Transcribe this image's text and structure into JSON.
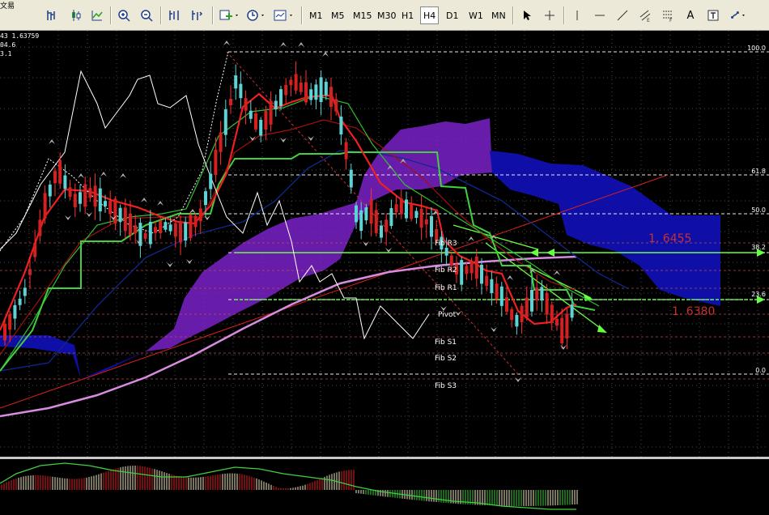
{
  "menu_fragment": "文易",
  "toolbar": {
    "timeframes": [
      "M1",
      "M5",
      "M15",
      "M30",
      "H1",
      "H4",
      "D1",
      "W1",
      "MN"
    ],
    "active_timeframe": "H4"
  },
  "info": {
    "line1": "43 1.63759",
    "line2": "04.6",
    "line3": "3.1"
  },
  "fib_levels": [
    {
      "label": "100.0"
    },
    {
      "label": "61.8"
    },
    {
      "label": "50.0"
    },
    {
      "label": "38.2"
    },
    {
      "label": "23.6"
    },
    {
      "label": "0.0"
    }
  ],
  "pivots": [
    {
      "label": "Fib R3"
    },
    {
      "label": "Fib R2"
    },
    {
      "label": "Fib R1"
    },
    {
      "label": "Pivot"
    },
    {
      "label": "Fib S1"
    },
    {
      "label": "Fib S2"
    },
    {
      "label": "Fib S3"
    }
  ],
  "annotations": {
    "upper_price": "1. 6455",
    "lower_price": "1. 6380"
  },
  "colors": {
    "background": "#000000",
    "bull_candle": "#5fd3d3",
    "bear_candle": "#d32020",
    "cloud_purple": "#7a22c8",
    "cloud_blue": "#1010b0",
    "fib_line": "#e8e8e8",
    "green_level": "#66ff44",
    "annotation_text": "#c83030"
  }
}
